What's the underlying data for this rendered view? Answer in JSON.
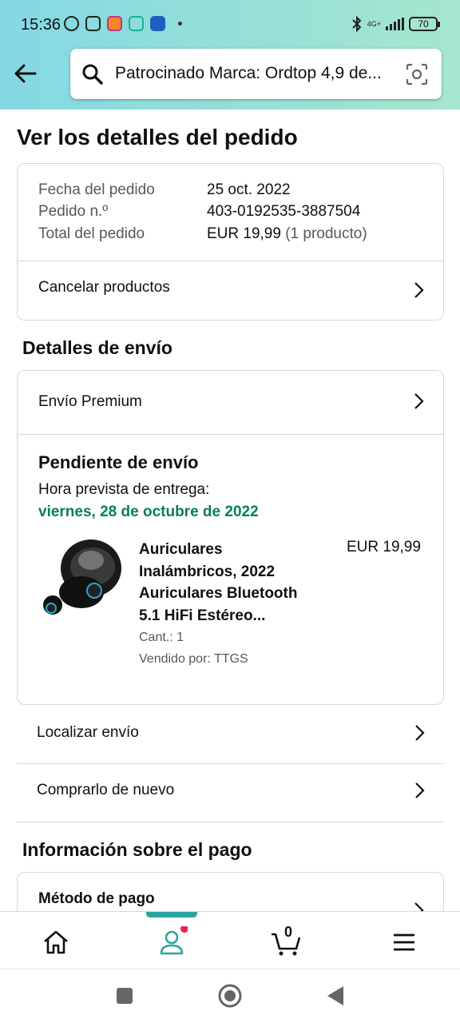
{
  "status_bar": {
    "time": "15:36",
    "network": "4G+",
    "battery": "70"
  },
  "header": {
    "search_text": "Patrocinado Marca: Ordtop 4,9 de..."
  },
  "page": {
    "title": "Ver los detalles del pedido"
  },
  "order_summary": {
    "date_label": "Fecha del pedido",
    "date_value": "25 oct. 2022",
    "number_label": "Pedido n.º",
    "number_value": "403-0192535-3887504",
    "total_label": "Total del pedido",
    "total_value": "EUR 19,99",
    "total_count": "(1 producto)",
    "cancel_label": "Cancelar productos"
  },
  "shipping": {
    "section_title": "Detalles de envío",
    "method": "Envío Premium",
    "status": "Pendiente de envío",
    "eta_label": "Hora prevista de entrega:",
    "eta_date": "viernes, 28 de octubre de 2022",
    "product": {
      "title": "Auriculares Inalámbricos, 2022 Auriculares Bluetooth 5.1 HiFi Estéreo...",
      "price": "EUR 19,99",
      "qty": "Cant.: 1",
      "seller": "Vendido por: TTGS"
    },
    "track_label": "Localizar envío",
    "rebuy_label": "Comprarlo de nuevo"
  },
  "payment": {
    "section_title": "Información sobre el pago",
    "method_label": "Método de pago"
  },
  "bottom_nav": {
    "cart_count": "0",
    "accent": "#2aa6a0",
    "notification_dot": "#e3245a"
  },
  "icons": [
    "back-arrow-icon",
    "search-icon",
    "camera-scan-icon",
    "chevron-right-icon",
    "home-icon",
    "account-icon",
    "cart-icon",
    "menu-icon",
    "square-nav-icon",
    "circle-nav-icon",
    "triangle-back-nav-icon"
  ]
}
